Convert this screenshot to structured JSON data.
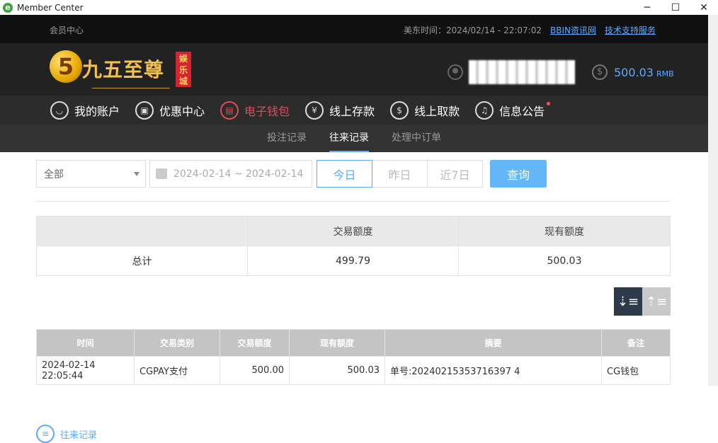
{
  "window": {
    "title": "Member Center"
  },
  "topbar": {
    "member_center": "会员中心",
    "us_time": "美东时间：2024/02/14 - 22:07:02",
    "link_news": "BBIN资讯网",
    "link_support": "技术支持服务"
  },
  "brand": {
    "logo_text": "九五至尊",
    "logo_numeral": "5",
    "badge": "娱乐城"
  },
  "account": {
    "balance": "500.03",
    "currency": "RMB"
  },
  "nav": [
    {
      "label": "我的账户",
      "icon": "user-icon"
    },
    {
      "label": "优惠中心",
      "icon": "gift-icon"
    },
    {
      "label": "电子钱包",
      "icon": "wallet-icon"
    },
    {
      "label": "线上存款",
      "icon": "deposit-icon"
    },
    {
      "label": "线上取款",
      "icon": "withdraw-icon"
    },
    {
      "label": "往来记录",
      "icon": "records-icon"
    },
    {
      "label": "信息公告",
      "icon": "bell-icon"
    }
  ],
  "subtabs": [
    "投注记录",
    "往来记录",
    "处理中订单"
  ],
  "filters": {
    "type_select": "全部",
    "date_range": "2024-02-14 ~ 2024-02-14",
    "range_buttons": [
      "今日",
      "昨日",
      "近7日"
    ],
    "query_label": "查询"
  },
  "summary": {
    "headers": [
      "",
      "交易额度",
      "现有额度"
    ],
    "row": [
      "总计",
      "499.79",
      "500.03"
    ]
  },
  "records": {
    "headers": [
      "时间",
      "交易类别",
      "交易额度",
      "现有额度",
      "摘要",
      "备注"
    ],
    "rows": [
      [
        "2024-02-14 22:05:44",
        "CGPAY支付",
        "500.00",
        "500.03",
        "单号:20240215353716397 4",
        "CG钱包"
      ]
    ]
  },
  "colors": {
    "accent_blue": "#5ea9ff",
    "accent_red": "#e04b5a",
    "query_button": "#63b6f7"
  }
}
